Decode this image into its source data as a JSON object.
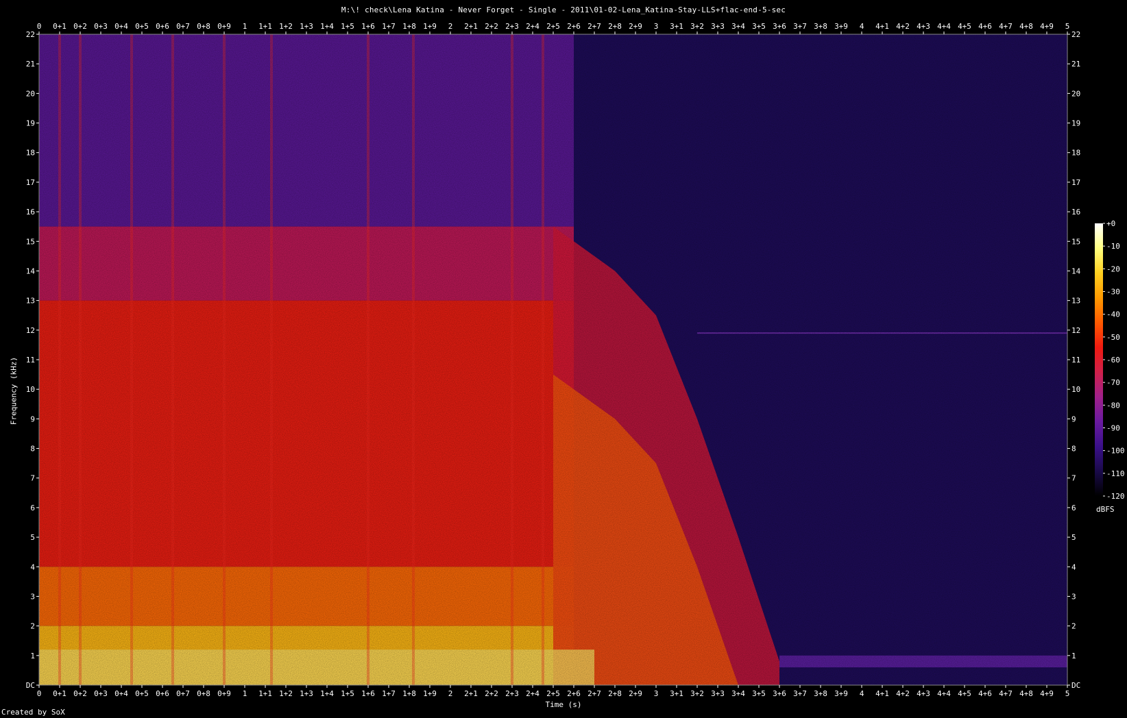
{
  "title": "M:\\! check\\Lena Katina - Never Forget - Single - 2011\\01-02-Lena_Katina-Stay-LLS+flac-end-5-sec",
  "credit": "Created by SoX",
  "chart_data": {
    "type": "heatmap",
    "title": "M:\\! check\\Lena Katina - Never Forget - Single - 2011\\01-02-Lena_Katina-Stay-LLS+flac-end-5-sec",
    "xlabel": "Time (s)",
    "ylabel": "Frequency (kHz)",
    "xlim": [
      0,
      5
    ],
    "ylim": [
      0,
      22
    ],
    "x_ticks": [
      "0",
      "0+1",
      "0+2",
      "0+3",
      "0+4",
      "0+5",
      "0+6",
      "0+7",
      "0+8",
      "0+9",
      "1",
      "1+1",
      "1+2",
      "1+3",
      "1+4",
      "1+5",
      "1+6",
      "1+7",
      "1+8",
      "1+9",
      "2",
      "2+1",
      "2+2",
      "2+3",
      "2+4",
      "2+5",
      "2+6",
      "2+7",
      "2+8",
      "2+9",
      "3",
      "3+1",
      "3+2",
      "3+3",
      "3+4",
      "3+5",
      "3+6",
      "3+7",
      "3+8",
      "3+9",
      "4",
      "4+1",
      "4+2",
      "4+3",
      "4+4",
      "4+5",
      "4+6",
      "4+7",
      "4+8",
      "4+9",
      "5"
    ],
    "y_ticks": [
      "DC",
      "1",
      "2",
      "3",
      "4",
      "5",
      "6",
      "7",
      "8",
      "9",
      "10",
      "11",
      "12",
      "13",
      "14",
      "15",
      "16",
      "17",
      "18",
      "19",
      "20",
      "21",
      "22"
    ],
    "colorbar": {
      "unit": "dBFS",
      "ticks": [
        "+0",
        "-10",
        "-20",
        "-30",
        "-40",
        "-50",
        "-60",
        "-70",
        "-80",
        "-90",
        "-100",
        "-110",
        "-120"
      ],
      "range": [
        -120,
        0
      ],
      "colors": [
        "#000000",
        "#1a0a4a",
        "#3a108a",
        "#6a1aa0",
        "#a0208a",
        "#d0204a",
        "#f01a10",
        "#ff5a00",
        "#ff9a00",
        "#ffd020",
        "#ffff80",
        "#ffffff"
      ]
    },
    "features": {
      "music_end_time_s": 2.6,
      "lowpass_fade": [
        [
          2.5,
          15.5
        ],
        [
          2.8,
          14
        ],
        [
          3.0,
          12.5
        ],
        [
          3.2,
          9
        ],
        [
          3.4,
          5
        ],
        [
          3.6,
          0.8
        ]
      ],
      "hum_line_khz": 11.9,
      "low_tone_khz": 1.0
    }
  }
}
